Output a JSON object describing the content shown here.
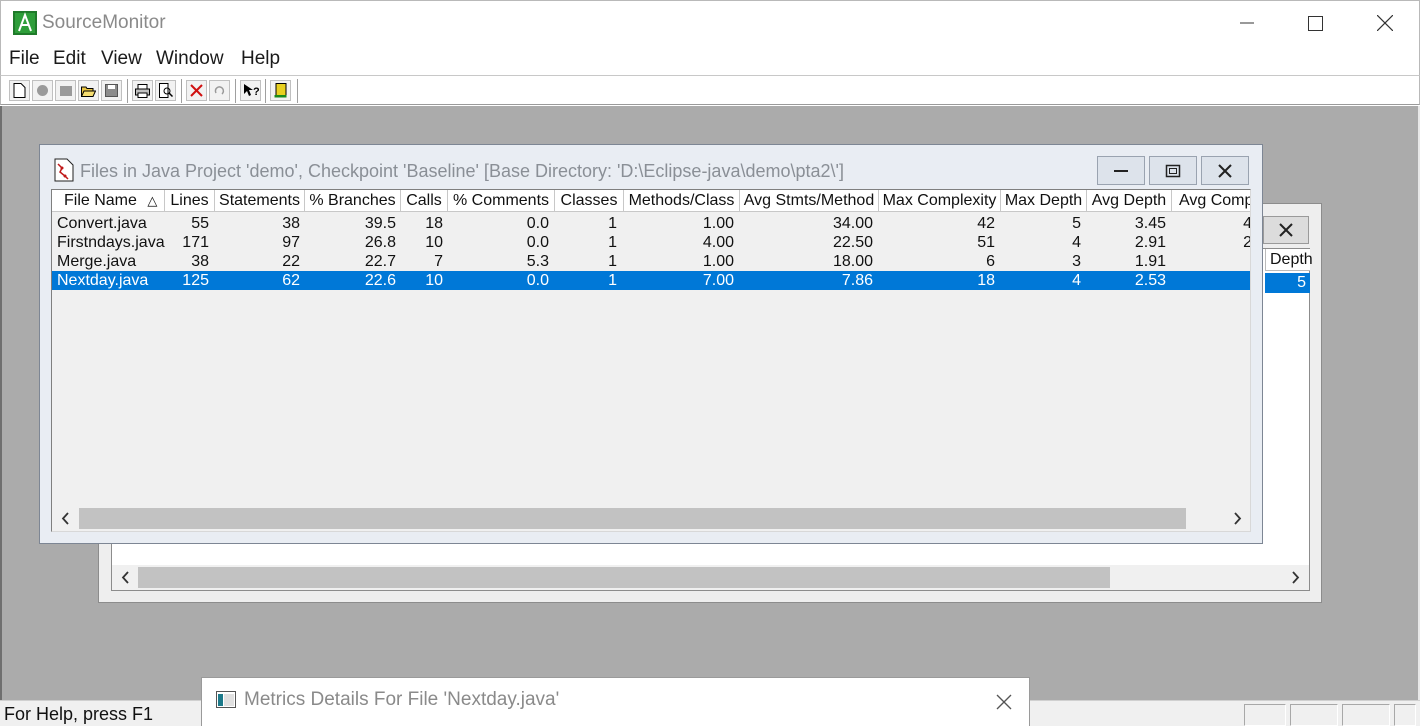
{
  "app": {
    "title": "SourceMonitor"
  },
  "menu": [
    "File",
    "Edit",
    "View",
    "Window",
    "Help"
  ],
  "toolbar": {
    "icons": [
      "new-file-icon",
      "new-checkpoint-icon",
      "add-files-icon",
      "open-icon",
      "save-icon",
      "print-icon",
      "print-preview-icon",
      "delete-icon",
      "undo-icon",
      "context-help-icon",
      "exit-icon"
    ]
  },
  "files_window": {
    "title": "Files in Java Project 'demo', Checkpoint 'Baseline'  [Base Directory: 'D:\\Eclipse-java\\demo\\pta2\\']",
    "columns": [
      "File Name",
      "Lines",
      "Statements",
      "% Branches",
      "Calls",
      "% Comments",
      "Classes",
      "Methods/Class",
      "Avg Stmts/Method",
      "Max Complexity",
      "Max Depth",
      "Avg Depth",
      "Avg Comp"
    ],
    "sort_indicator": "△",
    "rows": [
      {
        "cells": [
          "Convert.java",
          "55",
          "38",
          "39.5",
          "18",
          "0.0",
          "1",
          "1.00",
          "34.00",
          "42",
          "5",
          "3.45",
          "4"
        ]
      },
      {
        "cells": [
          "Firstndays.java",
          "171",
          "97",
          "26.8",
          "10",
          "0.0",
          "1",
          "4.00",
          "22.50",
          "51",
          "4",
          "2.91",
          "2"
        ]
      },
      {
        "cells": [
          "Merge.java",
          "38",
          "22",
          "22.7",
          "7",
          "5.3",
          "1",
          "1.00",
          "18.00",
          "6",
          "3",
          "1.91",
          ""
        ]
      },
      {
        "cells": [
          "Nextday.java",
          "125",
          "62",
          "22.6",
          "10",
          "0.0",
          "1",
          "7.00",
          "7.86",
          "18",
          "4",
          "2.53",
          ""
        ]
      }
    ],
    "selected_row": 3
  },
  "back_window": {
    "visible_header": "Depth",
    "visible_selected_value": "5"
  },
  "details_window": {
    "title": "Metrics Details For File 'Nextday.java'"
  },
  "status": {
    "text": "For Help, press F1"
  },
  "colors": {
    "selection": "#0078d7",
    "mdi_background": "#ababab"
  }
}
